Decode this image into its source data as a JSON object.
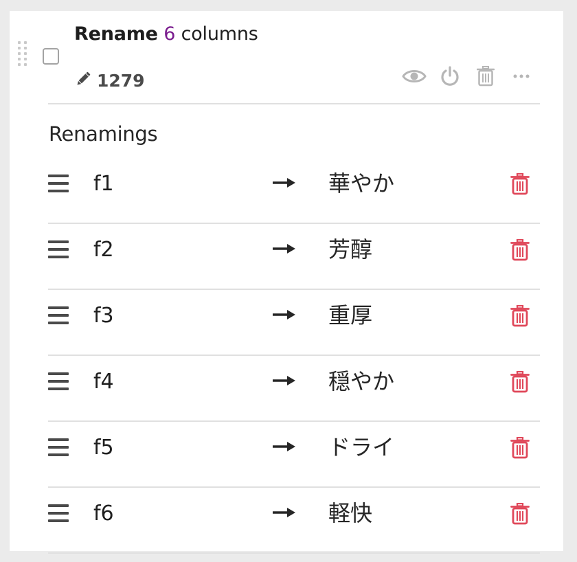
{
  "step": {
    "title_prefix": "Rename",
    "title_count": "6",
    "title_suffix": "columns",
    "step_id": "1279",
    "icons": {
      "drag": "grip-dots-icon",
      "edit": "pencil-icon",
      "preview": "eye-icon",
      "toggle": "power-icon",
      "delete": "trash-icon",
      "more": "ellipsis-icon"
    }
  },
  "section_label": "Renamings",
  "renamings": [
    {
      "from": "f1",
      "to": "華やか"
    },
    {
      "from": "f2",
      "to": "芳醇"
    },
    {
      "from": "f3",
      "to": "重厚"
    },
    {
      "from": "f4",
      "to": "穏やか"
    },
    {
      "from": "f5",
      "to": "ドライ"
    },
    {
      "from": "f6",
      "to": "軽快"
    }
  ],
  "row_icons": {
    "reorder": "hamburger-icon",
    "mapping": "arrow-right-icon",
    "remove": "trash-icon"
  },
  "colors": {
    "count_accent": "#7a1c8e",
    "delete_red": "#e0485a",
    "toolbar_icon": "#b6b6b6",
    "text": "#1e1e1e",
    "separator": "#e0e0e0",
    "background": "#ebebeb"
  }
}
